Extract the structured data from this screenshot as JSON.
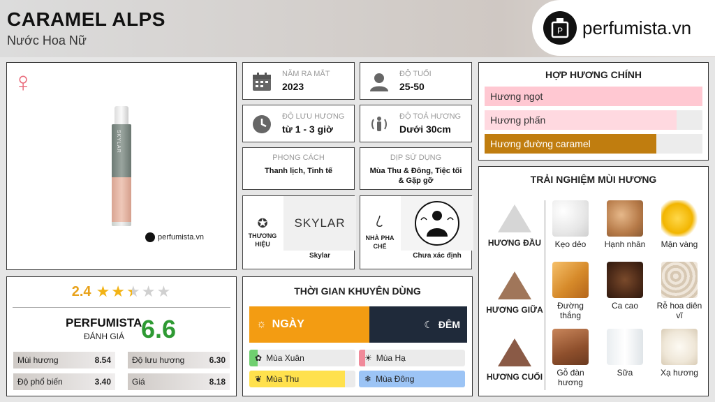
{
  "header": {
    "title": "CARAMEL ALPS",
    "subtitle": "Nước Hoa Nữ",
    "logo_text": "perfumista.vn"
  },
  "product": {
    "gender_icon": "female-symbol-icon",
    "bottle_brand": "SKYLAR",
    "watermark": "perfumista.vn"
  },
  "rating": {
    "score": "2.4",
    "stars_filled": 2.4,
    "stars_total": 5,
    "pf_label": "PERFUMISTA",
    "pf_sub": "ĐÁNH GIÁ",
    "pf_score": "6.6",
    "metrics": [
      {
        "label": "Mùi hương",
        "value": "8.54"
      },
      {
        "label": "Độ lưu hương",
        "value": "6.30"
      },
      {
        "label": "Độ phổ biến",
        "value": "3.40"
      },
      {
        "label": "Giá",
        "value": "8.18"
      }
    ]
  },
  "info": {
    "release": {
      "label": "NĂM RA MẮT",
      "value": "2023",
      "icon": "calendar-icon"
    },
    "age": {
      "label": "ĐỘ TUỔI",
      "value": "25-50",
      "icon": "person-icon"
    },
    "longevity": {
      "label": "ĐỘ LƯU HƯƠNG",
      "value": "từ 1 - 3 giờ",
      "icon": "clock-icon"
    },
    "sillage": {
      "label": "ĐỘ TOẢ HƯƠNG",
      "value": "Dưới 30cm",
      "icon": "sillage-icon"
    },
    "style": {
      "label": "PHONG CÁCH",
      "value": "Thanh lịch, Tinh tế"
    },
    "occasion": {
      "label": "DỊP SỬ DỤNG",
      "value": "Mùa Thu & Đông, Tiệc tối & Gặp gỡ"
    },
    "brand": {
      "label": "THƯƠNG HIỆU",
      "logo": "SKYLAR",
      "name": "Skylar",
      "icon": "star-badge-icon"
    },
    "perfumer": {
      "label": "NHÀ PHA CHẾ",
      "name": "Chưa xác định",
      "icon": "nose-icon"
    }
  },
  "time": {
    "title": "THỜI GIAN KHUYÊN DÙNG",
    "day_label": "NGÀY",
    "night_label": "ĐÊM",
    "day_share": 0.55,
    "seasons": [
      {
        "label": "Mùa Xuân",
        "level": 0.08,
        "color": "#6fcf6f"
      },
      {
        "label": "Mùa Hạ",
        "level": 0.06,
        "color": "#f08a9a"
      },
      {
        "label": "Mùa Thu",
        "level": 0.9,
        "color": "#ffe14d"
      },
      {
        "label": "Mùa Đông",
        "level": 1.0,
        "color": "#9cc4f5"
      }
    ]
  },
  "accords": {
    "title": "HỢP HƯƠNG CHÍNH",
    "items": [
      {
        "label": "Hương ngọt",
        "level": 1.0,
        "color": "#ffc8d2"
      },
      {
        "label": "Hương phấn",
        "level": 0.88,
        "color": "#ffd9e0"
      },
      {
        "label": "Hương đường caramel",
        "level": 0.79,
        "color": "#c07d0f"
      }
    ]
  },
  "notes": {
    "title": "TRẢI NGHIỆM MÙI HƯƠNG",
    "tiers": [
      {
        "label": "HƯƠNG ĐẦU",
        "items": [
          "Kẹo dẻo",
          "Hạnh nhân",
          "Mận vàng"
        ]
      },
      {
        "label": "HƯƠNG GIỮA",
        "items": [
          "Đường thắng",
          "Ca cao",
          "Rễ hoa diên vĩ"
        ]
      },
      {
        "label": "HƯƠNG CUỐI",
        "items": [
          "Gỗ đàn hương",
          "Sữa",
          "Xạ hương"
        ]
      }
    ]
  }
}
